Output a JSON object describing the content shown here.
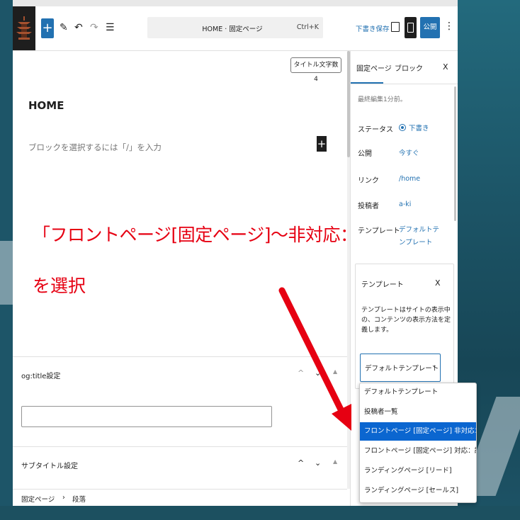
{
  "toolbar": {
    "add_symbol": "+",
    "command_title": "HOME · 固定ページ",
    "command_shortcut": "Ctrl+K",
    "save_draft": "下書き保存",
    "publish": "公開",
    "more": "⋮"
  },
  "editor": {
    "title_count_badge": "タイトル文字数 4",
    "page_title": "HOME",
    "block_placeholder": "ブロックを選択するには「/」を入力",
    "inline_add": "+",
    "annotation_line1": "「フロントページ[固定ページ]～非対応：記事一覧」",
    "annotation_line2": "を選択"
  },
  "metaboxes": {
    "og_title_label": "og:title設定",
    "og_title_value": "",
    "subtitle_label": "サブタイトル設定"
  },
  "breadcrumb": {
    "root": "固定ページ",
    "separator": "›",
    "current": "段落"
  },
  "sidebar": {
    "tab_page": "固定ページ",
    "tab_block": "ブロック",
    "close": "X",
    "last_edited": "最終編集1分前。",
    "status_label": "ステータス",
    "status_value": "下書き",
    "publish_label": "公開",
    "publish_value": "今すぐ",
    "link_label": "リンク",
    "link_value": "/home",
    "author_label": "投稿者",
    "author_value": "a-ki",
    "template_label": "テンプレート",
    "template_value": "デフォルトテンプレート"
  },
  "template_panel": {
    "title": "テンプレート",
    "close": "X",
    "description": "テンプレートはサイトの表示中の、コンテンツの表示方法を定義します。",
    "selected": "デフォルトテンプレート",
    "chevron": "⌄"
  },
  "dropdown": {
    "options": [
      "デフォルトテンプレート",
      "投稿者一覧",
      "フロントページ [固定ページ] 非対応：記事一覧",
      "フロントページ [固定ページ] 対応：記事一覧",
      "ランディングページ [リード]",
      "ランディングページ [セールス]"
    ],
    "highlighted_index": 2
  },
  "colors": {
    "accent": "#2271b1",
    "annotation": "#e60012",
    "highlight": "#0b66d0"
  }
}
